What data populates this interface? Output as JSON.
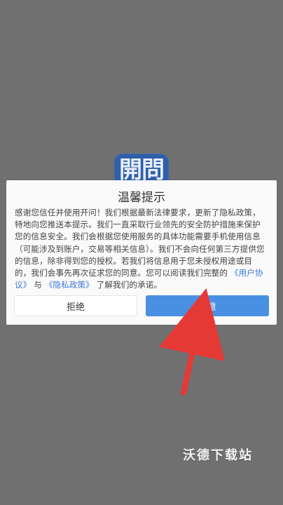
{
  "app": {
    "icon_text": "開問"
  },
  "dialog": {
    "title": "温馨提示",
    "body": {
      "part1": "感谢您信任并使用开问！我们根据最新法律要求，更新了隐私政策，特地向您推送本提示。我们一直采取行业领先的安全防护措施来保护您的信息安全。我们会根据您使用服务的具体功能需要手机使用信息（可能涉及到账户，交易等相关信息）。我们不会向任何第三方提供您的信息，除非得到您的授权。若我们将信息用于您未授权用途或目的，我们会事先再次征求您的同意。您可以阅读我们完整的",
      "link1": "《用户协议》",
      "connector": "与",
      "link2": "《隐私政策》",
      "part2": "了解我们的承诺。"
    },
    "decline_label": "拒绝",
    "agree_label": "同意"
  },
  "watermark": "沃德下载站",
  "colors": {
    "overlay": "#707070",
    "dialog_bg": "#fafafa",
    "agree_button": "#4a90e2",
    "link": "#3f78d9",
    "arrow": "#e53935"
  }
}
